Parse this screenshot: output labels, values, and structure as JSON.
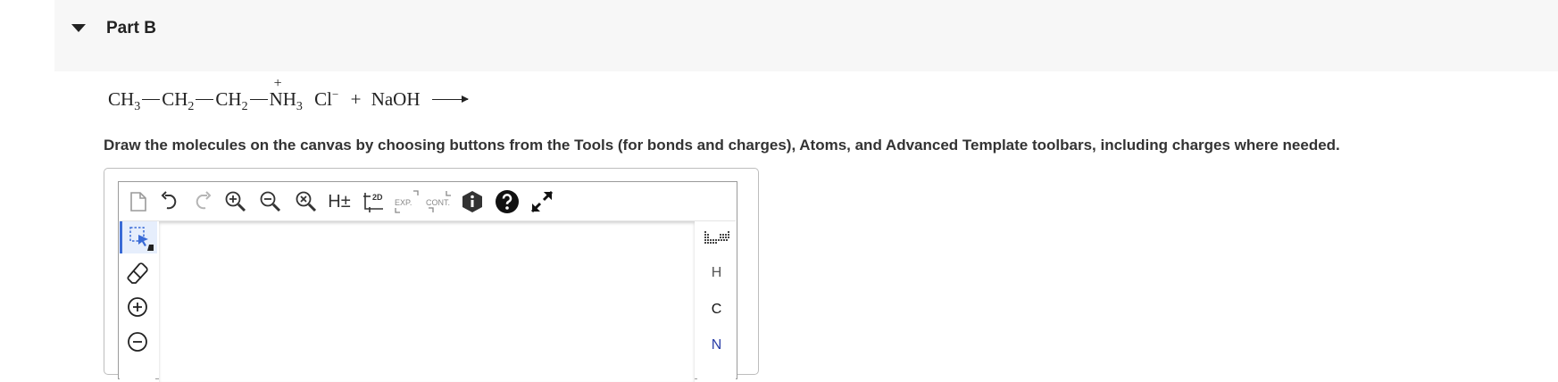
{
  "part": {
    "title": "Part B"
  },
  "equation": {
    "ch3": "CH",
    "ch3_sub": "3",
    "ch2a": "CH",
    "ch2a_sub": "2",
    "ch2b": "CH",
    "ch2b_sub": "2",
    "nh3": "NH",
    "nh3_sub": "3",
    "n_charge": "+",
    "cl": "Cl",
    "cl_charge": "−",
    "plus": "+",
    "naoh": "NaOH"
  },
  "instructions": "Draw the molecules on the canvas by choosing buttons from the Tools (for bonds and charges), Atoms, and Advanced Template toolbars, including charges where needed.",
  "toolbar": {
    "h_toggle_label": "H±",
    "twod_label": "2D",
    "exp_label": "EXP.",
    "cont_label": "CONT."
  },
  "atoms": [
    {
      "symbol": "H",
      "color": "#555555"
    },
    {
      "symbol": "C",
      "color": "#111111"
    },
    {
      "symbol": "N",
      "color": "#2b3fa8"
    }
  ],
  "colors": {
    "active_tool_bg": "#e6eefc",
    "accent": "#3a6bd6",
    "header_bg": "#f7f7f7"
  }
}
